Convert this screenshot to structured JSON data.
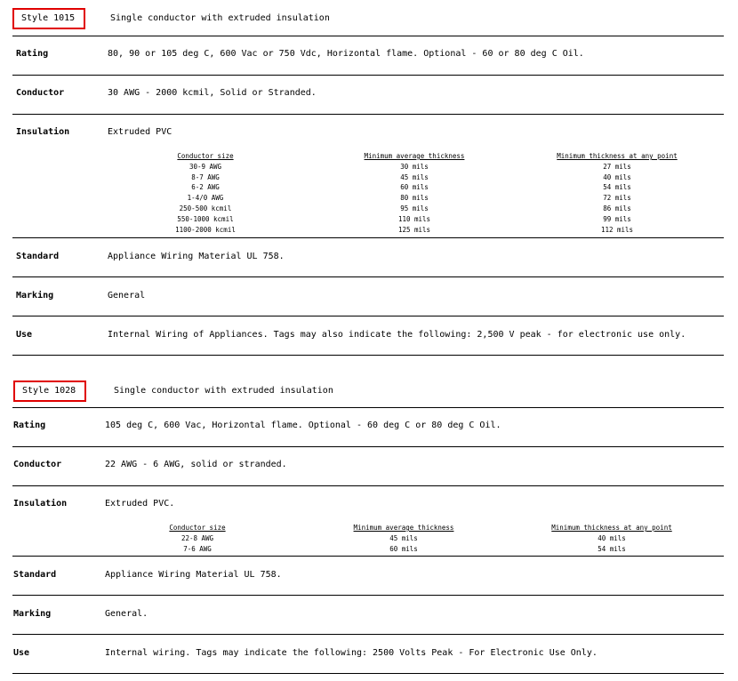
{
  "cards": [
    {
      "style_label": "Style 1015",
      "description": "Single conductor with extruded insulation",
      "rows": {
        "rating": {
          "label": "Rating",
          "value": "80, 90 or 105 deg C, 600 Vac or 750 Vdc, Horizontal flame. Optional - 60 or 80 deg C Oil."
        },
        "conductor": {
          "label": "Conductor",
          "value": "30 AWG - 2000 kcmil, Solid or Stranded."
        },
        "insulation": {
          "label": "Insulation",
          "value": "Extruded PVC"
        },
        "standard": {
          "label": "Standard",
          "value": "Appliance Wiring Material UL 758."
        },
        "marking": {
          "label": "Marking",
          "value": "General"
        },
        "use": {
          "label": "Use",
          "value": "Internal Wiring of Appliances. Tags may also indicate the following: 2,500 V peak - for electronic use only."
        }
      },
      "insulation_table": {
        "headers": [
          "Conductor size",
          "Minimum average thickness",
          "Minimum thickness at any point"
        ],
        "rows": [
          [
            "30-9 AWG",
            "30 mils",
            "27 mils"
          ],
          [
            "8-7 AWG",
            "45 mils",
            "40 mils"
          ],
          [
            "6-2 AWG",
            "60 mils",
            "54 mils"
          ],
          [
            "1-4/0 AWG",
            "80 mils",
            "72 mils"
          ],
          [
            "250-500 kcmil",
            "95 mils",
            "86 mils"
          ],
          [
            "550-1000 kcmil",
            "110 mils",
            "99 mils"
          ],
          [
            "1100-2000 kcmil",
            "125 mils",
            "112 mils"
          ]
        ]
      }
    },
    {
      "style_label": "Style 1028",
      "description": "Single conductor with extruded insulation",
      "rows": {
        "rating": {
          "label": "Rating",
          "value": "105 deg C, 600 Vac, Horizontal flame. Optional - 60 deg C or 80 deg C Oil."
        },
        "conductor": {
          "label": "Conductor",
          "value": "22 AWG - 6 AWG, solid or stranded."
        },
        "insulation": {
          "label": "Insulation",
          "value": "Extruded PVC."
        },
        "standard": {
          "label": "Standard",
          "value": "Appliance Wiring Material UL 758."
        },
        "marking": {
          "label": "Marking",
          "value": "General."
        },
        "use": {
          "label": "Use",
          "value": "Internal wiring. Tags may indicate the following: 2500 Volts Peak - For Electronic Use Only."
        }
      },
      "insulation_table": {
        "headers": [
          "Conductor size",
          "Minimum average thickness",
          "Minimum thickness at any point"
        ],
        "rows": [
          [
            "22-8 AWG",
            "45 mils",
            "40 mils"
          ],
          [
            "7-6 AWG",
            "60 mils",
            "54 mils"
          ]
        ]
      }
    }
  ]
}
